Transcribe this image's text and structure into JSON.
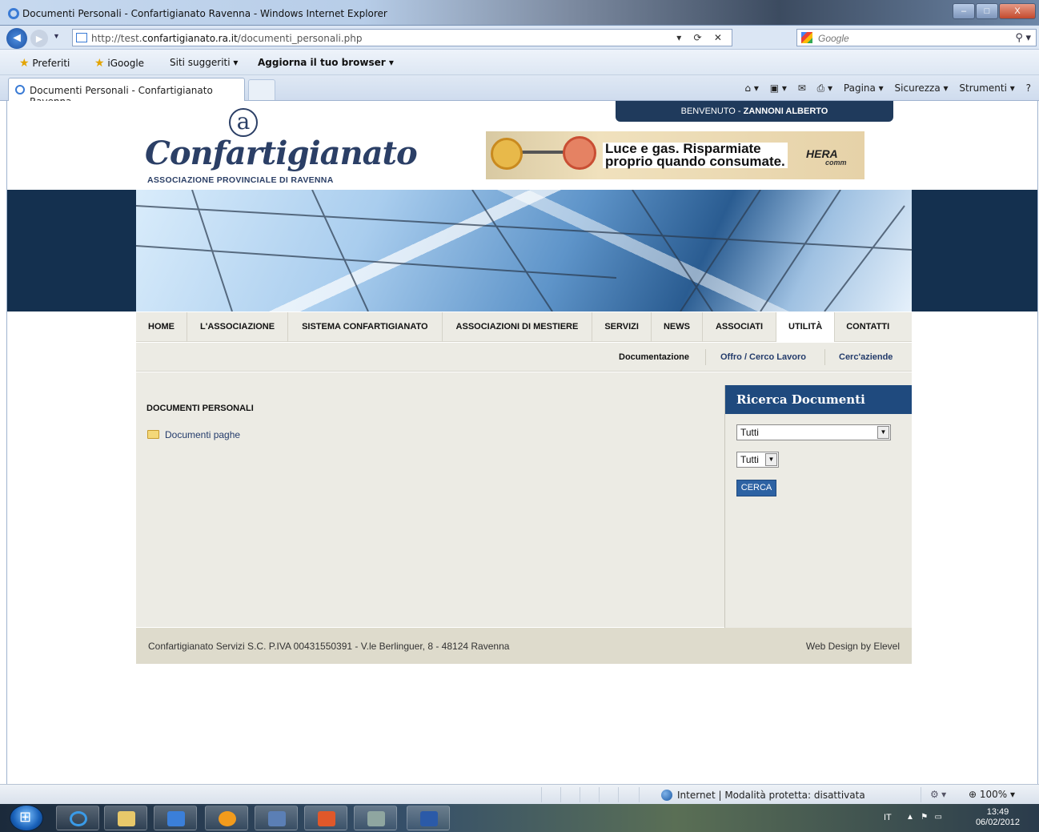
{
  "window": {
    "title": "Documenti Personali - Confartigianato Ravenna - Windows Internet Explorer",
    "min": "–",
    "max": "□",
    "close": "X"
  },
  "addressbar": {
    "url_prefix": "http://test.",
    "url_domain": "confartigianato.ra.it",
    "url_path": "/documenti_personali.php",
    "tools": "▾ ⟳ ✕",
    "search_placeholder": "Google"
  },
  "favorites": {
    "preferiti": "Preferiti",
    "igoogle": "iGoogle",
    "siti": "Siti suggeriti ▾",
    "aggiorna": "Aggiorna il tuo browser ▾"
  },
  "tab": {
    "label": "Documenti Personali - Confartigianato Ravenna"
  },
  "commandbar": {
    "pagina": "Pagina ▾",
    "sicurezza": "Sicurezza ▾",
    "strumenti": "Strumenti ▾",
    "help": "?"
  },
  "site": {
    "welcome_prefix": "BENVENUTO - ",
    "welcome_user": "ZANNONI ALBERTO",
    "logo_symbol": "a",
    "logo_word": "Confartigianato",
    "logo_sub": "ASSOCIAZIONE PROVINCIALE DI RAVENNA",
    "ad_line1": "Luce e gas. Risparmiate",
    "ad_line2": "proprio quando consumate.",
    "ad_brand": "HERA",
    "ad_brand_sub": "comm"
  },
  "mainnav": [
    "HOME",
    "L'ASSOCIAZIONE",
    "SISTEMA CONFARTIGIANATO",
    "ASSOCIAZIONI DI MESTIERE",
    "SERVIZI",
    "NEWS",
    "ASSOCIATI",
    "UTILITÀ",
    "CONTATTI"
  ],
  "subnav": {
    "documentazione": "Documentazione",
    "lavoro": "Offro  / Cerco Lavoro",
    "aziende": "Cerc'aziende"
  },
  "content": {
    "heading": "DOCUMENTI PERSONALI",
    "link": "Documenti paghe"
  },
  "sidebar": {
    "title": "Ricerca Documenti",
    "select1": "Tutti",
    "select2": "Tutti",
    "button": "CERCA"
  },
  "footer": {
    "left": "Confartigianato Servizi S.C. P.IVA 00431550391 - V.le Berlinguer, 8 - 48124 Ravenna",
    "right": "Web Design by Elevel"
  },
  "statusbar": {
    "zone": "Internet | Modalità protetta: disattivata",
    "zoom": "100%"
  },
  "taskbar": {
    "lang": "IT",
    "time": "13:49",
    "date": "06/02/2012"
  }
}
